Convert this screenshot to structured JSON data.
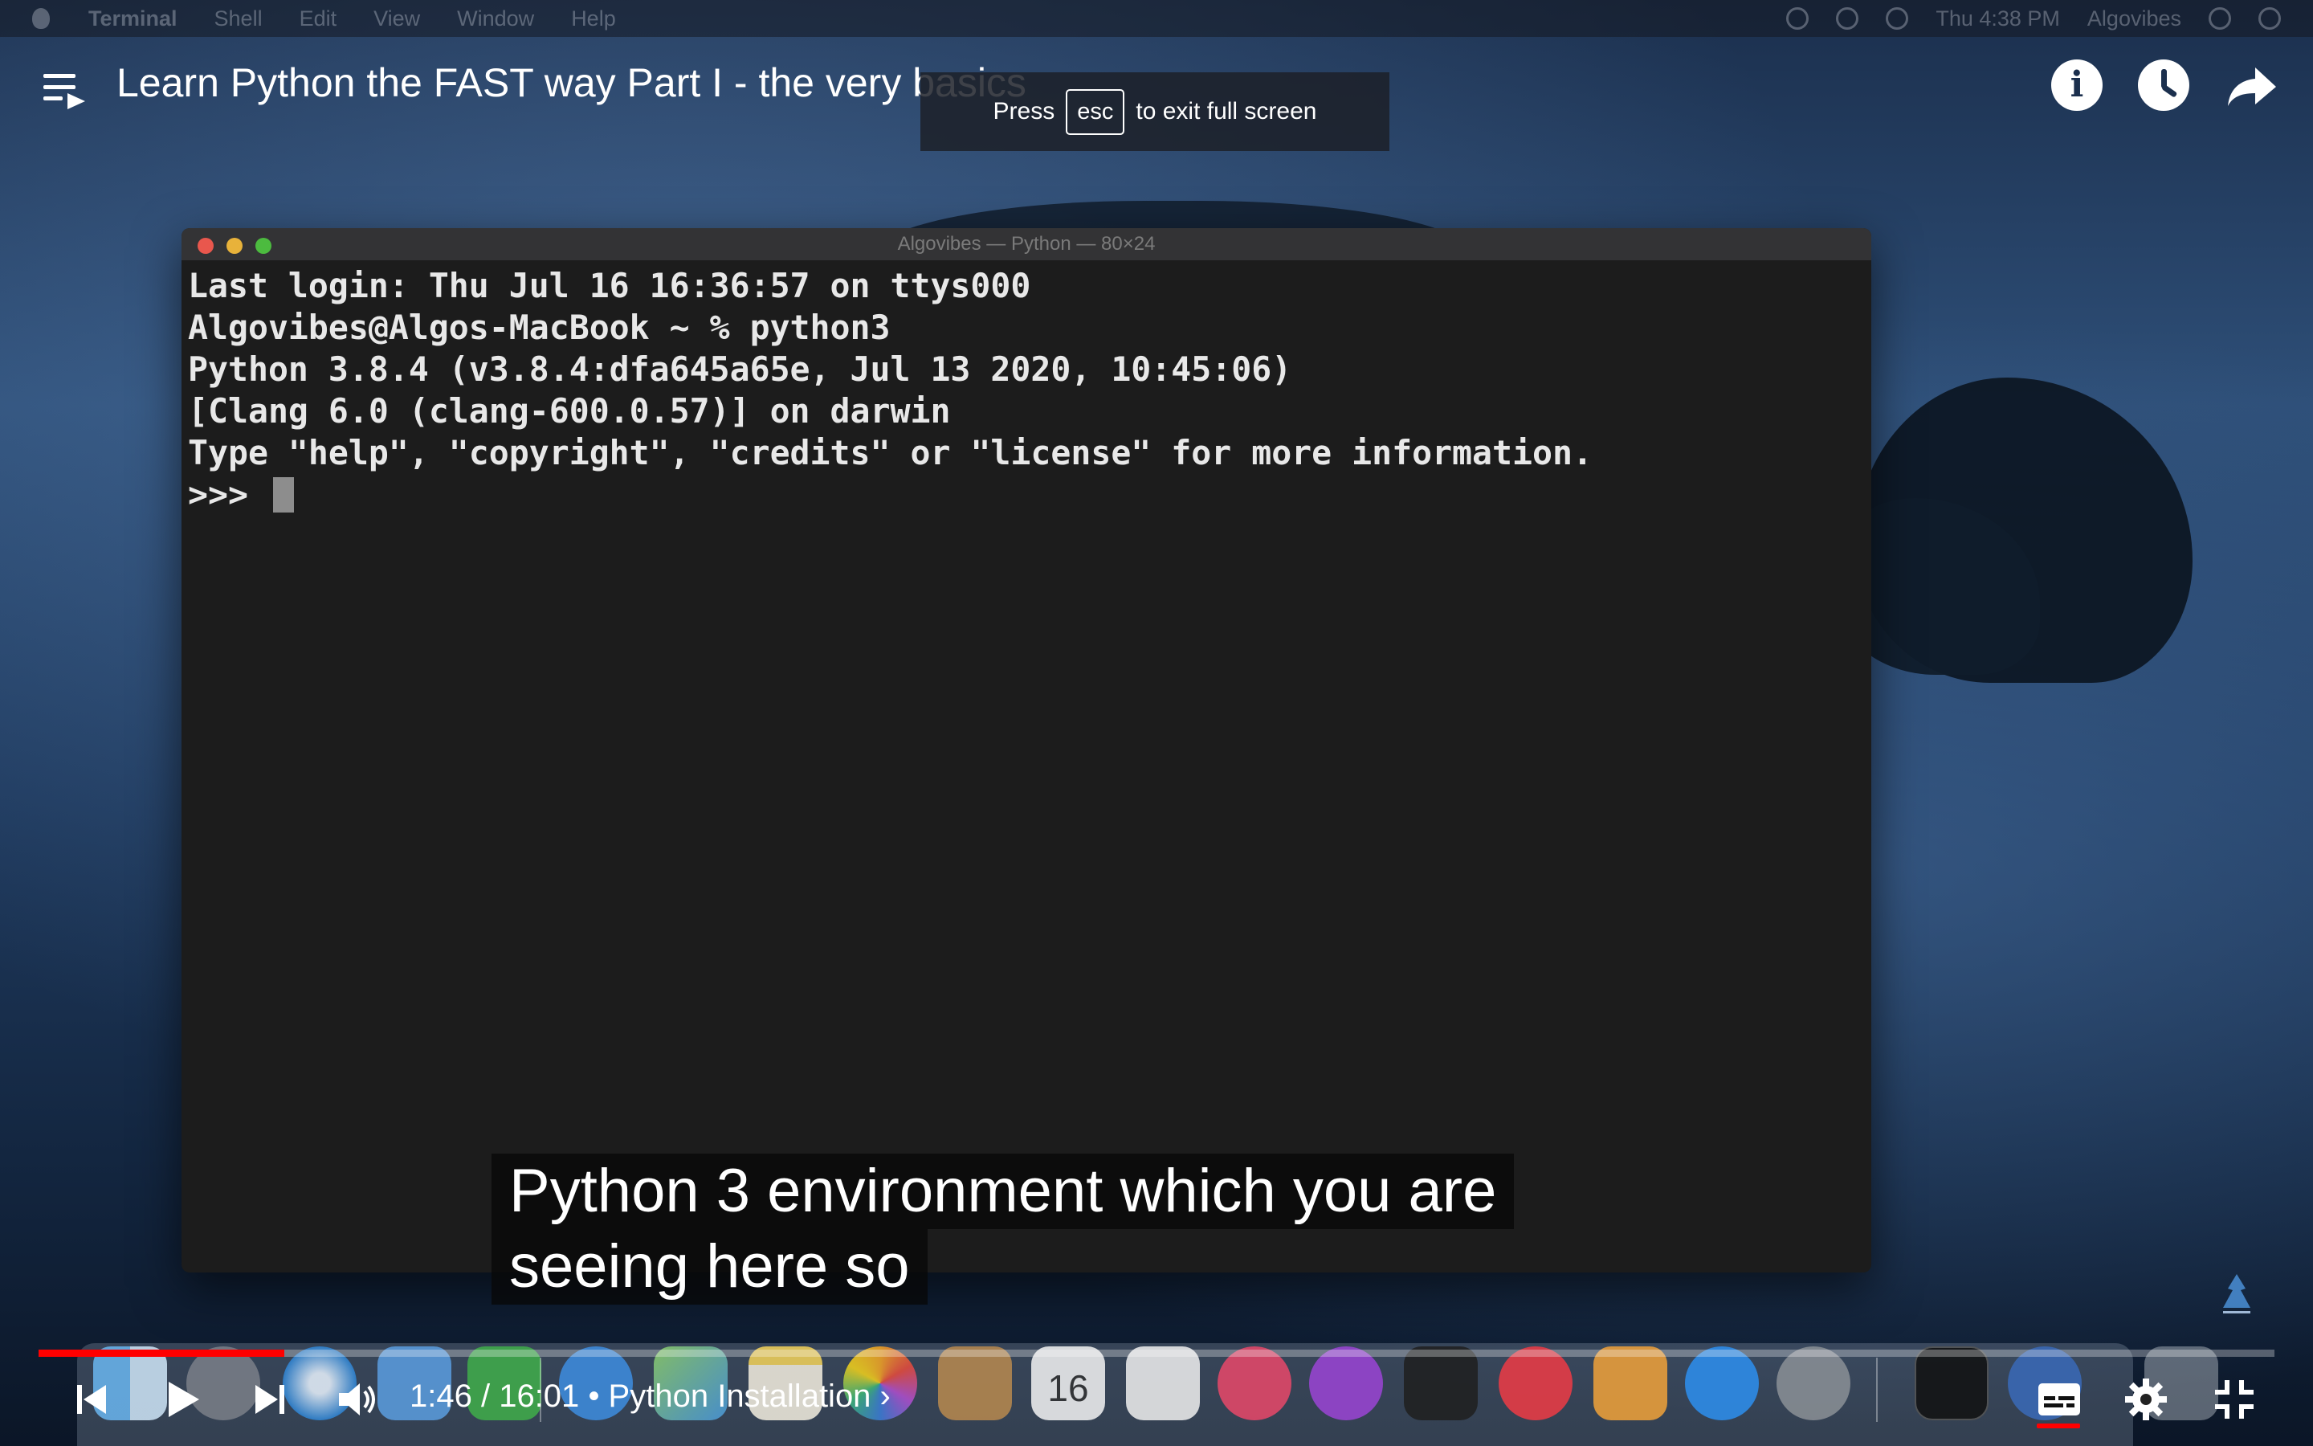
{
  "menubar": {
    "items": [
      "Terminal",
      "Shell",
      "Edit",
      "View",
      "Window",
      "Help"
    ],
    "clock": "Thu 4:38 PM",
    "user": "Algovibes"
  },
  "player": {
    "title": "Learn Python the FAST way Part I - the very basics",
    "fullscreen_hint": {
      "before": "Press",
      "key": "esc",
      "after": "to exit full screen"
    },
    "time_current": "1:46",
    "time_total": "16:01",
    "time_separator": " / ",
    "chapter": "• Python Installation ›",
    "progress_fraction": 0.11,
    "progress_color": "#ff0000"
  },
  "terminal": {
    "title": "Algovibes — Python — 80×24",
    "lines": [
      "Last login: Thu Jul 16 16:36:57 on ttys000",
      "Algovibes@Algos-MacBook ~ % python3",
      "Python 3.8.4 (v3.8.4:dfa645a65e, Jul 13 2020, 10:45:06)",
      "[Clang 6.0 (clang-600.0.57)] on darwin",
      "Type \"help\", \"copyright\", \"credits\" or \"license\" for more information."
    ],
    "prompt": ">>> "
  },
  "captions": {
    "line1": "Python 3 environment which you are",
    "line2": "seeing here so"
  },
  "dock": {
    "calendar_day": "16",
    "apps": [
      "finder-icon",
      "launchpad-icon",
      "safari-icon",
      "mail-icon",
      "facetime-icon",
      "maps-icon",
      "photos-icon",
      "notes-icon",
      "calendar-icon",
      "reminders-icon",
      "music-icon",
      "podcasts-icon",
      "tv-icon",
      "news-icon",
      "pages-icon",
      "app-store-icon",
      "system-preferences-icon",
      "terminal-icon",
      "python-launcher-icon",
      "trash-icon"
    ]
  }
}
